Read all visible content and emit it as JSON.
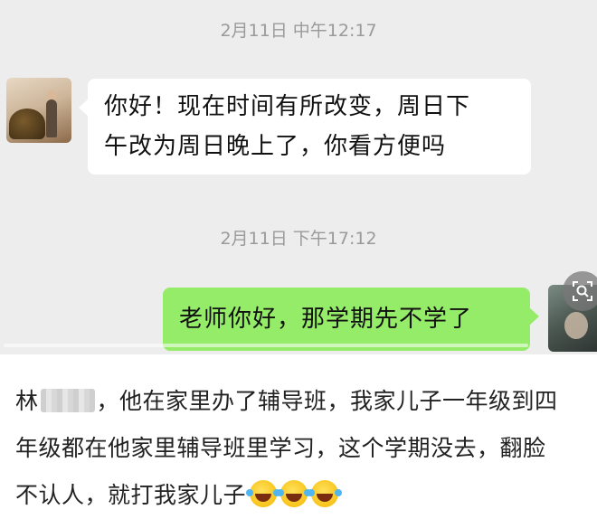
{
  "chat": {
    "timestamps": [
      "2月11日 中午12:17",
      "2月11日 下午17:12"
    ],
    "messages": [
      {
        "side": "left",
        "line1": "你好！现在时间有所改变，周日下",
        "line2": "午改为周日晚上了，你看方便吗"
      },
      {
        "side": "right",
        "text": "老师你好，那学期先不学了"
      }
    ],
    "video_progress": 0.0
  },
  "caption": {
    "name_prefix": "林",
    "line1_rest": "，他在家里办了辅导班，我家儿子一年级到四",
    "line2": "年级都在他家里辅导班里学习，这个学期没去，翻脸",
    "line3": "不认人，就打我家儿子",
    "emoji": [
      "face-with-tears-of-joy",
      "face-with-tears-of-joy",
      "face-with-tears-of-joy"
    ]
  },
  "colors": {
    "chat_bg": "#ededed",
    "sent_bubble": "#95ec69",
    "received_bubble": "#ffffff"
  }
}
